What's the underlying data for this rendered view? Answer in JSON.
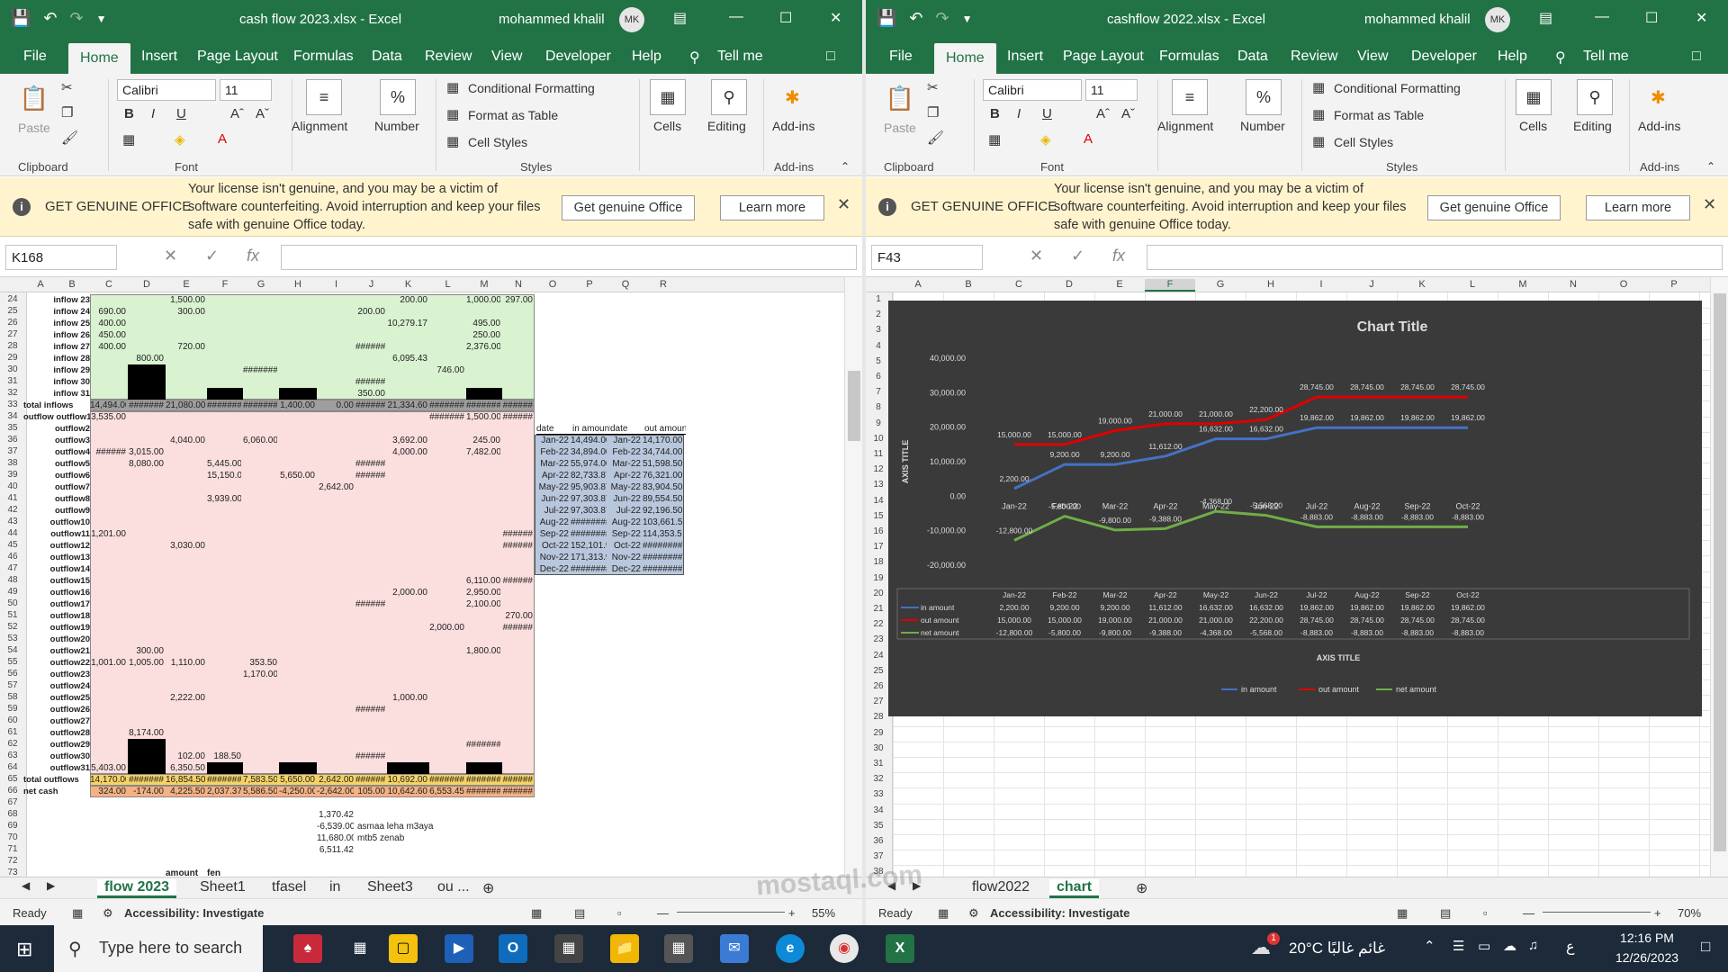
{
  "left": {
    "doc_title": "cash flow 2023.xlsx  -  Excel",
    "user": "mohammed khalil",
    "initials": "MK",
    "tabs": [
      "File",
      "Home",
      "Insert",
      "Page Layout",
      "Formulas",
      "Data",
      "Review",
      "View",
      "Developer",
      "Help",
      "Tell me"
    ],
    "font_name": "Calibri",
    "font_size": "11",
    "namebox": "K168",
    "sheets": [
      "flow 2023",
      "Sheet1",
      "tfasel",
      "in",
      "Sheet3",
      "ou ..."
    ],
    "active_sheet": "flow 2023",
    "zoom": "55%",
    "rows_start": 24,
    "rows_end": 73,
    "labels": [
      "inflow 23",
      "inflow 24",
      "inflow 25",
      "inflow 26",
      "inflow 27",
      "inflow 28",
      "inflow 29",
      "inflow 30",
      "inflow 31",
      "total inflows",
      "outflow outflow1",
      "outflow2",
      "outflow3",
      "outflow4",
      "outflow5",
      "outflow6",
      "outflow7",
      "outflow8",
      "outflow9",
      "outflow10",
      "outflow11",
      "outflow12",
      "outflow13",
      "outflow14",
      "outflow15",
      "outflow16",
      "outflow17",
      "outflow18",
      "outflow19",
      "outflow20",
      "outflow21",
      "outflow22",
      "outflow23",
      "outflow24",
      "outflow25",
      "outflow26",
      "outflow27",
      "outflow28",
      "outflow29",
      "outflow30",
      "outflow31",
      "total outflows",
      "net cash"
    ],
    "cols": [
      "A",
      "B",
      "C",
      "D",
      "E",
      "F",
      "G",
      "H",
      "I",
      "J",
      "K",
      "L",
      "M",
      "N",
      "O",
      "P",
      "Q",
      "R"
    ],
    "summary_headers": [
      "date",
      "in amount",
      "date",
      "out amount"
    ],
    "summary_rows": [
      [
        "Jan-22",
        "14,494.00",
        "Jan-22",
        "14,170.00"
      ],
      [
        "Feb-22",
        "34,894.00",
        "Feb-22",
        "34,744.00"
      ],
      [
        "Mar-22",
        "55,974.00",
        "Mar-22",
        "51,598.50"
      ],
      [
        "Apr-22",
        "82,733.87",
        "Apr-22",
        "76,321.00"
      ],
      [
        "May-22",
        "95,903.87",
        "May-22",
        "83,904.50"
      ],
      [
        "Jun-22",
        "97,303.87",
        "Jun-22",
        "89,554.50"
      ],
      [
        "Jul-22",
        "97,303.87",
        "Jul-22",
        "92,196.50"
      ],
      [
        "Aug-22",
        "########",
        "Aug-22",
        "103,661.50"
      ],
      [
        "Sep-22",
        "########",
        "Sep-22",
        "114,353.50"
      ],
      [
        "Oct-22",
        "152,101.92",
        "Oct-22",
        "########"
      ],
      [
        "Nov-22",
        "171,313.92",
        "Nov-22",
        "########"
      ],
      [
        "Dec-22",
        "########",
        "Dec-22",
        "########"
      ]
    ],
    "total_inflows": [
      "14,494.00",
      "#######",
      "21,080.00",
      "#######",
      "#######",
      "1,400.00",
      "0.00",
      "######",
      "21,334.60",
      "#######",
      "#######",
      "######"
    ],
    "total_outflows": [
      "14,170.00",
      "#######",
      "16,854.50",
      "#######",
      "7,583.50",
      "5,650.00",
      "2,642.00",
      "######",
      "10,692.00",
      "#######",
      "#######",
      "######"
    ],
    "net_cash": [
      "324.00",
      "-174.00",
      "4,225.50",
      "2,037.37",
      "5,586.50",
      "-4,250.00",
      "-2,642.00",
      "105.00",
      "10,642.60",
      "6,553.45",
      "#######",
      "######"
    ],
    "loose_values": [
      "1,370.42",
      "-6,539.00",
      "11,680.00",
      "6,511.42"
    ],
    "loose_notes": [
      "asmaa leha m3aya",
      "mtb5 zenab"
    ],
    "amount_label": "amount",
    "fen_label": "fen",
    "sample_cells": [
      {
        "r": 24,
        "c": "E",
        "v": "1,500.00"
      },
      {
        "r": 24,
        "c": "K",
        "v": "200.00"
      },
      {
        "r": 24,
        "c": "M",
        "v": "1,000.00"
      },
      {
        "r": 24,
        "c": "N",
        "v": "297.00"
      },
      {
        "r": 25,
        "c": "C",
        "v": "690.00"
      },
      {
        "r": 25,
        "c": "E",
        "v": "300.00"
      },
      {
        "r": 25,
        "c": "J",
        "v": "200.00"
      },
      {
        "r": 26,
        "c": "C",
        "v": "400.00"
      },
      {
        "r": 26,
        "c": "K",
        "v": "10,279.17"
      },
      {
        "r": 26,
        "c": "M",
        "v": "495.00"
      },
      {
        "r": 27,
        "c": "C",
        "v": "450.00"
      },
      {
        "r": 27,
        "c": "M",
        "v": "250.00"
      },
      {
        "r": 28,
        "c": "C",
        "v": "400.00"
      },
      {
        "r": 28,
        "c": "E",
        "v": "720.00"
      },
      {
        "r": 28,
        "c": "J",
        "v": "######"
      },
      {
        "r": 28,
        "c": "M",
        "v": "2,376.00"
      },
      {
        "r": 29,
        "c": "D",
        "v": "800.00"
      },
      {
        "r": 29,
        "c": "K",
        "v": "6,095.43"
      },
      {
        "r": 30,
        "c": "G",
        "v": "#######"
      },
      {
        "r": 30,
        "c": "L",
        "v": "746.00"
      },
      {
        "r": 31,
        "c": "J",
        "v": "######"
      },
      {
        "r": 32,
        "c": "J",
        "v": "350.00"
      },
      {
        "r": 34,
        "c": "C",
        "v": "3,535.00"
      },
      {
        "r": 34,
        "c": "L",
        "v": "#######"
      },
      {
        "r": 34,
        "c": "M",
        "v": "1,500.00"
      },
      {
        "r": 34,
        "c": "N",
        "v": "######"
      },
      {
        "r": 36,
        "c": "E",
        "v": "4,040.00"
      },
      {
        "r": 36,
        "c": "G",
        "v": "6,060.00"
      },
      {
        "r": 36,
        "c": "K",
        "v": "3,692.00"
      },
      {
        "r": 36,
        "c": "M",
        "v": "245.00"
      },
      {
        "r": 37,
        "c": "C",
        "v": "######"
      },
      {
        "r": 37,
        "c": "D",
        "v": "3,015.00"
      },
      {
        "r": 37,
        "c": "K",
        "v": "4,000.00"
      },
      {
        "r": 37,
        "c": "M",
        "v": "7,482.00"
      },
      {
        "r": 38,
        "c": "D",
        "v": "8,080.00"
      },
      {
        "r": 38,
        "c": "F",
        "v": "5,445.00"
      },
      {
        "r": 38,
        "c": "J",
        "v": "######"
      },
      {
        "r": 39,
        "c": "F",
        "v": "15,150.00"
      },
      {
        "r": 39,
        "c": "H",
        "v": "5,650.00"
      },
      {
        "r": 39,
        "c": "J",
        "v": "######"
      },
      {
        "r": 40,
        "c": "I",
        "v": "2,642.00"
      },
      {
        "r": 41,
        "c": "F",
        "v": "3,939.00"
      },
      {
        "r": 44,
        "c": "C",
        "v": "1,201.00"
      },
      {
        "r": 44,
        "c": "N",
        "v": "######"
      },
      {
        "r": 45,
        "c": "E",
        "v": "3,030.00"
      },
      {
        "r": 45,
        "c": "N",
        "v": "######"
      },
      {
        "r": 48,
        "c": "M",
        "v": "6,110.00"
      },
      {
        "r": 48,
        "c": "N",
        "v": "######"
      },
      {
        "r": 49,
        "c": "K",
        "v": "2,000.00"
      },
      {
        "r": 49,
        "c": "M",
        "v": "2,950.00"
      },
      {
        "r": 50,
        "c": "J",
        "v": "######"
      },
      {
        "r": 50,
        "c": "M",
        "v": "2,100.00"
      },
      {
        "r": 51,
        "c": "N",
        "v": "270.00"
      },
      {
        "r": 52,
        "c": "L",
        "v": "2,000.00"
      },
      {
        "r": 52,
        "c": "N",
        "v": "######"
      },
      {
        "r": 54,
        "c": "D",
        "v": "300.00"
      },
      {
        "r": 54,
        "c": "M",
        "v": "1,800.00"
      },
      {
        "r": 55,
        "c": "C",
        "v": "1,001.00"
      },
      {
        "r": 55,
        "c": "D",
        "v": "1,005.00"
      },
      {
        "r": 55,
        "c": "E",
        "v": "1,110.00"
      },
      {
        "r": 55,
        "c": "G",
        "v": "353.50"
      },
      {
        "r": 56,
        "c": "G",
        "v": "1,170.00"
      },
      {
        "r": 58,
        "c": "E",
        "v": "2,222.00"
      },
      {
        "r": 58,
        "c": "K",
        "v": "1,000.00"
      },
      {
        "r": 59,
        "c": "J",
        "v": "######"
      },
      {
        "r": 61,
        "c": "D",
        "v": "8,174.00"
      },
      {
        "r": 62,
        "c": "M",
        "v": "#######"
      },
      {
        "r": 63,
        "c": "E",
        "v": "102.00"
      },
      {
        "r": 63,
        "c": "F",
        "v": "188.50"
      },
      {
        "r": 63,
        "c": "J",
        "v": "######"
      },
      {
        "r": 64,
        "c": "C",
        "v": "5,403.00"
      },
      {
        "r": 64,
        "c": "E",
        "v": "6,350.50"
      }
    ]
  },
  "right": {
    "doc_title": "cashflow 2022.xlsx  -  Excel",
    "user": "mohammed khalil",
    "initials": "MK",
    "tabs": [
      "File",
      "Home",
      "Insert",
      "Page Layout",
      "Formulas",
      "Data",
      "Review",
      "View",
      "Developer",
      "Help",
      "Tell me"
    ],
    "font_name": "Calibri",
    "font_size": "11",
    "namebox": "F43",
    "sheets": [
      "flow2022",
      "chart"
    ],
    "active_sheet": "chart",
    "zoom": "70%",
    "cols": [
      "A",
      "B",
      "C",
      "D",
      "E",
      "F",
      "G",
      "H",
      "I",
      "J",
      "K",
      "L",
      "M",
      "N",
      "O",
      "P"
    ],
    "rows_start": 1,
    "rows_end": 38
  },
  "ribbon_labels": {
    "paste": "Paste",
    "clipboard": "Clipboard",
    "font": "Font",
    "alignment": "Alignment",
    "number": "Number",
    "conditional": "Conditional Formatting",
    "format_table": "Format as Table",
    "cell_styles": "Cell Styles",
    "styles": "Styles",
    "cells": "Cells",
    "editing": "Editing",
    "addins": "Add-ins",
    "addins_group": "Add-ins"
  },
  "license_bar": {
    "title": "GET GENUINE OFFICE",
    "message": "Your license isn't genuine, and you may be a victim of software counterfeiting. Avoid interruption and keep your files safe with genuine Office today.",
    "button_primary": "Get genuine Office",
    "button_secondary": "Learn more"
  },
  "status": {
    "ready": "Ready",
    "accessibility": "Accessibility: Investigate"
  },
  "taskbar": {
    "search_placeholder": "Type here to search",
    "weather": "20°C  غائم غالبًا",
    "lang": "ع",
    "time": "12:16 PM",
    "date": "12/26/2023",
    "weather_badge": "1"
  },
  "watermark": "mostaql.com",
  "colors": {
    "excel_green": "#217346",
    "inflow_fill": "#d9f2d0",
    "outflow_fill": "#fbdede",
    "summary_fill": "#b8c7dc",
    "total_fill": "#f4b183",
    "chart_bg": "#3a3a3a",
    "in_amount": "#4472c4",
    "out_amount": "#e00000",
    "net_amount": "#70ad47"
  },
  "chart_data": {
    "type": "line",
    "title": "Chart Title",
    "xlabel": "AXIS TITLE",
    "ylabel": "AXIS TITLE",
    "ylim": [
      -20000,
      40000
    ],
    "yticks": [
      "40,000.00",
      "30,000.00",
      "20,000.00",
      "10,000.00",
      "0.00",
      "-10,000.00",
      "-20,000.00"
    ],
    "categories": [
      "Jan-22",
      "Feb-22",
      "Mar-22",
      "Apr-22",
      "May-22",
      "Jun-22",
      "Jul-22",
      "Aug-22",
      "Sep-22",
      "Oct-22"
    ],
    "legend_position": "bottom",
    "series": [
      {
        "name": "in amount",
        "color": "#4472c4",
        "values": [
          2200,
          9200,
          9200,
          11612,
          16632,
          16632,
          19862,
          19862,
          19862,
          19862
        ],
        "labels": [
          "2,200.00",
          "9,200.00",
          "9,200.00",
          "11,612.00",
          "16,632.00",
          "16,632.00",
          "19,862.00",
          "19,862.00",
          "19,862.00",
          "19,862.00"
        ]
      },
      {
        "name": "out amount",
        "color": "#e00000",
        "values": [
          15000,
          15000,
          19000,
          21000,
          21000,
          22200,
          28745,
          28745,
          28745,
          28745
        ],
        "labels": [
          "15,000.00",
          "15,000.00",
          "19,000.00",
          "21,000.00",
          "21,000.00",
          "22,200.00",
          "28,745.00",
          "28,745.00",
          "28,745.00",
          "28,745.00"
        ]
      },
      {
        "name": "net amount",
        "color": "#70ad47",
        "values": [
          -12800,
          -5800,
          -9800,
          -9388,
          -4368,
          -5568,
          -8883,
          -8883,
          -8883,
          -8883
        ],
        "labels": [
          "-12,800.00",
          "-5,800.00",
          "-9,800.00",
          "-9,388.00",
          "-4,368.00",
          "-5,568.00",
          "-8,883.00",
          "-8,883.00",
          "-8,883.00",
          "-8,883.00"
        ]
      }
    ]
  }
}
